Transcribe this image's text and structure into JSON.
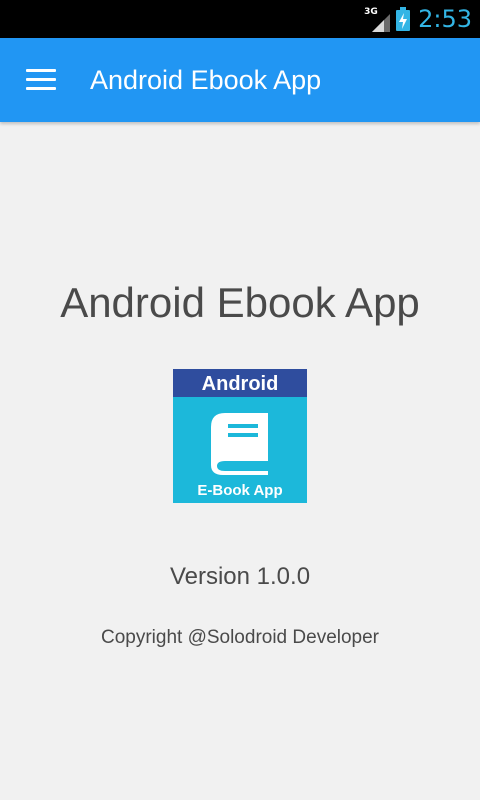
{
  "status_bar": {
    "network_type": "3G",
    "time": "2:53",
    "signal_icon": "signal-bars-icon",
    "battery_icon": "battery-charging-icon",
    "accent_color": "#33b5e5"
  },
  "app_bar": {
    "menu_icon": "hamburger-menu-icon",
    "title": "Android Ebook App",
    "color": "#2196f3"
  },
  "about": {
    "title": "Android Ebook App",
    "logo": {
      "top_text": "Android",
      "bottom_text": "E-Book App",
      "icon": "book-icon",
      "band_color": "#2f4d9e",
      "body_color": "#1cb8da"
    },
    "version": "Version 1.0.0",
    "copyright": "Copyright @Solodroid Developer"
  }
}
